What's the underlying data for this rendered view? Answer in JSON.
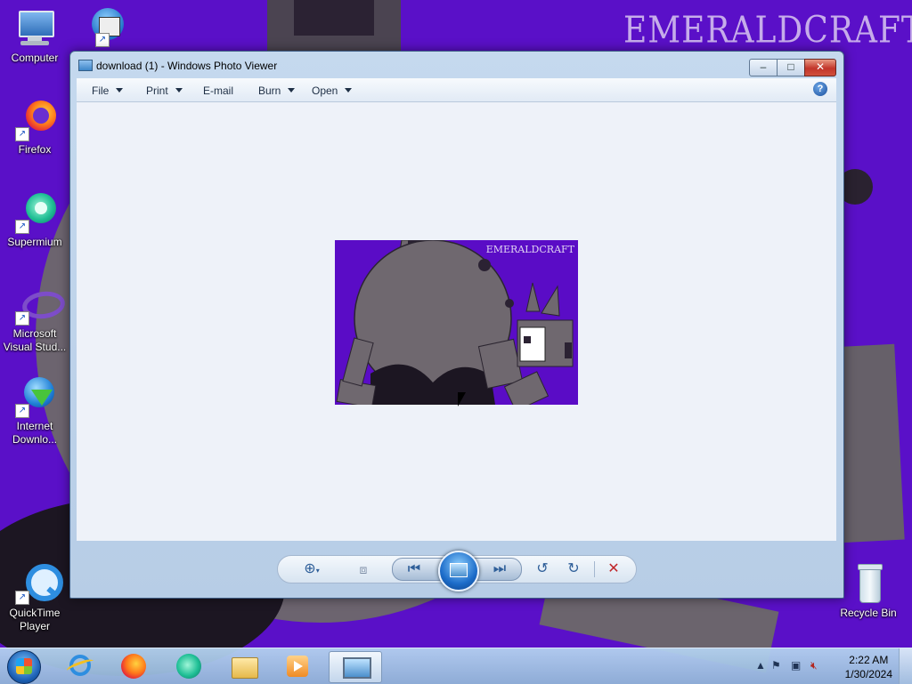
{
  "desktop": {
    "watermark": "EMERALDCRAFT",
    "icons": [
      {
        "label": "Computer",
        "icon": "computer-icon"
      },
      {
        "label": "",
        "icon": "movie-maker-icon"
      },
      {
        "label": "Firefox",
        "icon": "firefox-icon"
      },
      {
        "label": "Supermium",
        "icon": "supermium-icon"
      },
      {
        "label": "Microsoft Visual Stud...",
        "icon": "visual-studio-icon"
      },
      {
        "label": "Internet Downlo...",
        "icon": "internet-download-manager-icon"
      },
      {
        "label": "QuickTime Player",
        "icon": "quicktime-icon"
      },
      {
        "label": "Recycle Bin",
        "icon": "recycle-bin-icon"
      }
    ]
  },
  "window": {
    "title": "download (1) - Windows Photo Viewer",
    "controls": {
      "minimize": "–",
      "maximize": "□",
      "close": "✕"
    },
    "menu": [
      {
        "label": "File",
        "dropdown": true
      },
      {
        "label": "Print",
        "dropdown": true
      },
      {
        "label": "E-mail",
        "dropdown": false
      },
      {
        "label": "Burn",
        "dropdown": true
      },
      {
        "label": "Open",
        "dropdown": true
      }
    ],
    "help": "?",
    "photo": {
      "watermark": "EMERALDCRAFT",
      "background": "#5a0cc6"
    },
    "toolbar": {
      "zoom": "⊕",
      "actual_size": "⧈",
      "previous": "⏮",
      "next": "⏭",
      "rotate_ccw": "↺",
      "rotate_cw": "↻",
      "delete": "✕"
    }
  },
  "taskbar": {
    "pinned": [
      "internet-explorer-icon",
      "firefox-icon",
      "supermium-icon",
      "file-explorer-icon",
      "media-player-icon",
      "photo-viewer-icon"
    ],
    "time": "2:22 AM",
    "date": "1/30/2024"
  },
  "colors": {
    "wallpaper": "#5a10c8",
    "accent": "#2f5f99",
    "delete": "#c0262a"
  }
}
